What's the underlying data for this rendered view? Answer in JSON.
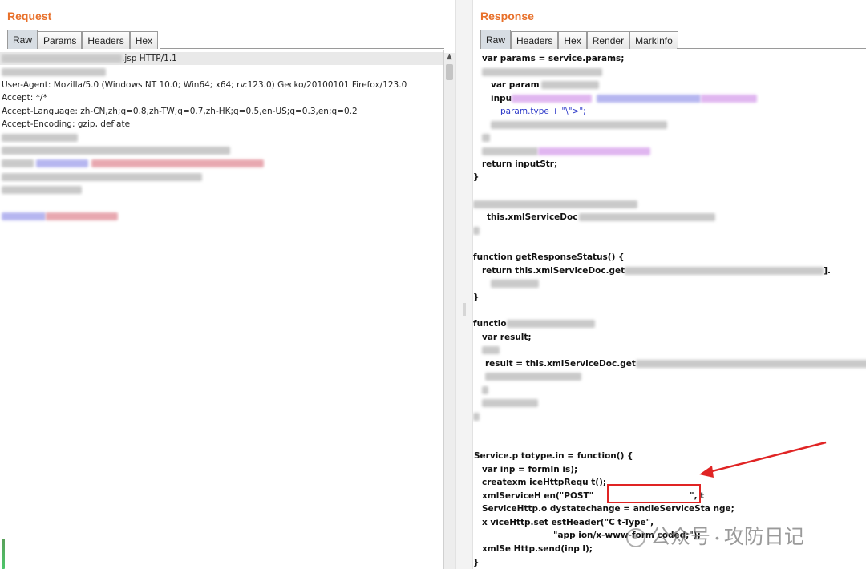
{
  "request": {
    "title": "Request",
    "tabs": [
      "Raw",
      "Params",
      "Headers",
      "Hex"
    ],
    "active_tab": "Raw",
    "lines": [
      ".jsp HTTP/1.1",
      "",
      "User-Agent: Mozilla/5.0 (Windows NT 10.0; Win64; x64; rv:123.0) Gecko/20100101 Firefox/123.0",
      "Accept: */*",
      "Accept-Language: zh-CN,zh;q=0.8,zh-TW;q=0.7,zh-HK;q=0.5,en-US;q=0.3,en;q=0.2",
      "Accept-Encoding: gzip, deflate"
    ]
  },
  "response": {
    "title": "Response",
    "tabs": [
      "Raw",
      "Headers",
      "Hex",
      "Render",
      "MarkInfo"
    ],
    "active_tab": "Raw",
    "code": [
      "var params = service.params;",
      "var param",
      "inpu",
      "param.type + \"\\\">\";",
      "return inputStr;",
      "}",
      "this.xmlServiceDoc",
      "function getResponseStatus() {",
      "return this.xmlServiceDoc.get",
      "].",
      "}",
      "functio",
      "var result;",
      "result = this.xmlServiceDoc.get",
      "Service.p  totype.in    = function() {",
      "var inp      = formIn     is);",
      "createxm     iceHttpRequ   t();",
      "xmlServiceH      en(\"POST\"",
      "\", t",
      "ServiceHttp.o    dystatechange =   andleServiceSta      nge;",
      "x      viceHttp.set      estHeader(\"C     t-Type\",",
      "\"app     ion/x-www-form     coded;\");",
      "xmlSe       Http.send(inp      l);",
      "}"
    ]
  },
  "watermark": {
    "channel": "公众号",
    "name": "攻防日记"
  },
  "colors": {
    "panel_title": "#e8702a",
    "highlight_box": "#e02424",
    "arrow": "#e02424",
    "code_blue": "#2a36c8"
  }
}
